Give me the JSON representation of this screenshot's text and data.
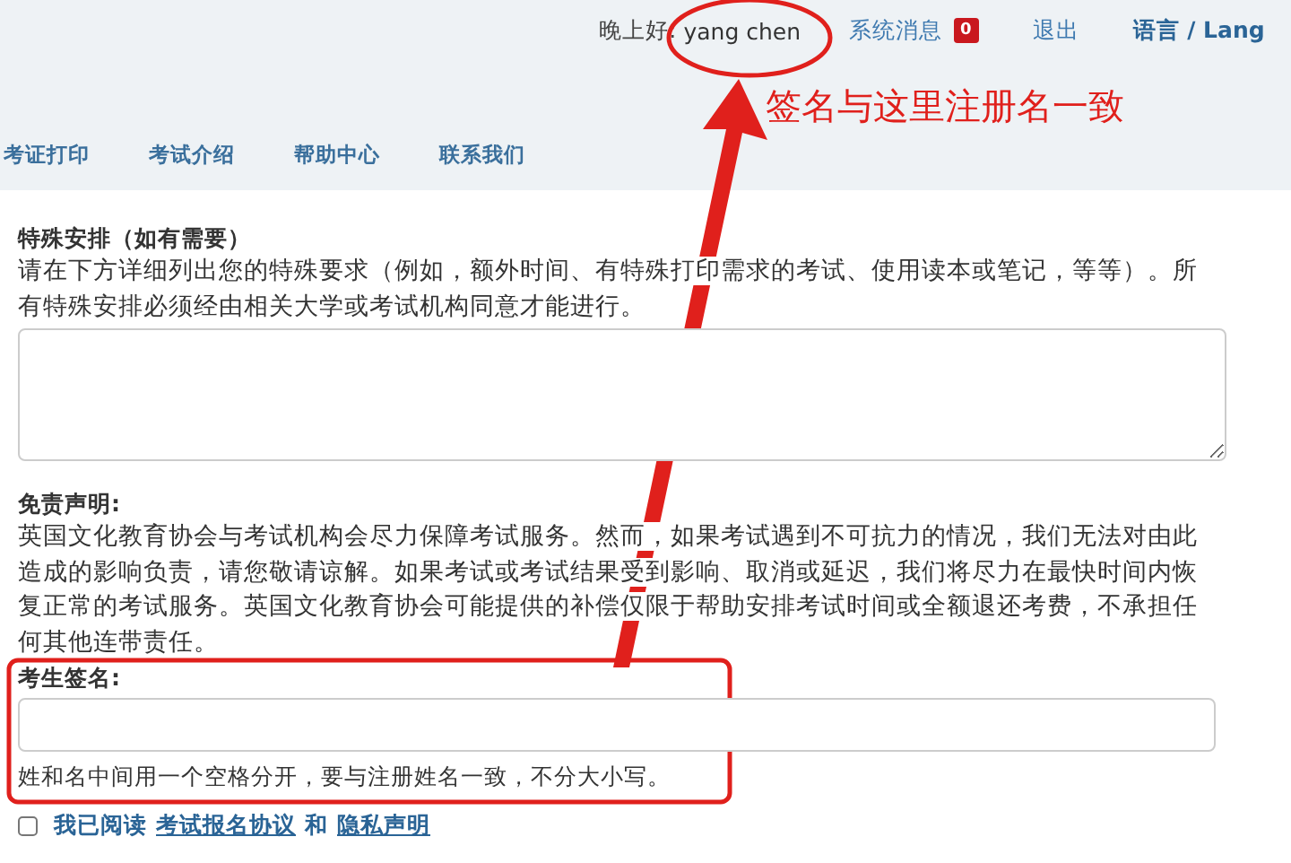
{
  "top_bar": {
    "greeting": "晚上好:",
    "username": "yang chen",
    "messages": {
      "label": "系统消息",
      "count": "0"
    },
    "logout": "退出",
    "language": "语言 / Lang"
  },
  "nav": [
    {
      "label": "考证打印"
    },
    {
      "label": "考试介绍"
    },
    {
      "label": "帮助中心"
    },
    {
      "label": "联系我们"
    }
  ],
  "special": {
    "title": "特殊安排（如有需要）",
    "description": "请在下方详细列出您的特殊要求（例如，额外时间、有特殊打印需求的考试、使用读本或笔记，等等）。所有特殊安排必须经由相关大学或考试机构同意才能进行。"
  },
  "disclaimer": {
    "title": "免责声明:",
    "text": "英国文化教育协会与考试机构会尽力保障考试服务。然而，如果考试遇到不可抗力的情况，我们无法对由此造成的影响负责，请您敬请谅解。如果考试或考试结果受到影响、取消或延迟，我们将尽力在最快时间内恢复正常的考试服务。英国文化教育协会可能提供的补偿仅限于帮助安排考试时间或全额退还考费，不承担任何其他连带责任。"
  },
  "signature": {
    "label": "考生签名:",
    "hint": "姓和名中间用一个空格分开，要与注册姓名一致，不分大小写。"
  },
  "agreement": {
    "checked": false,
    "prefix": "我已阅读",
    "link_1": "考试报名协议",
    "joiner": "和",
    "link_2": "隐私声明"
  },
  "annotation": {
    "text": "签名与这里注册名一致"
  }
}
